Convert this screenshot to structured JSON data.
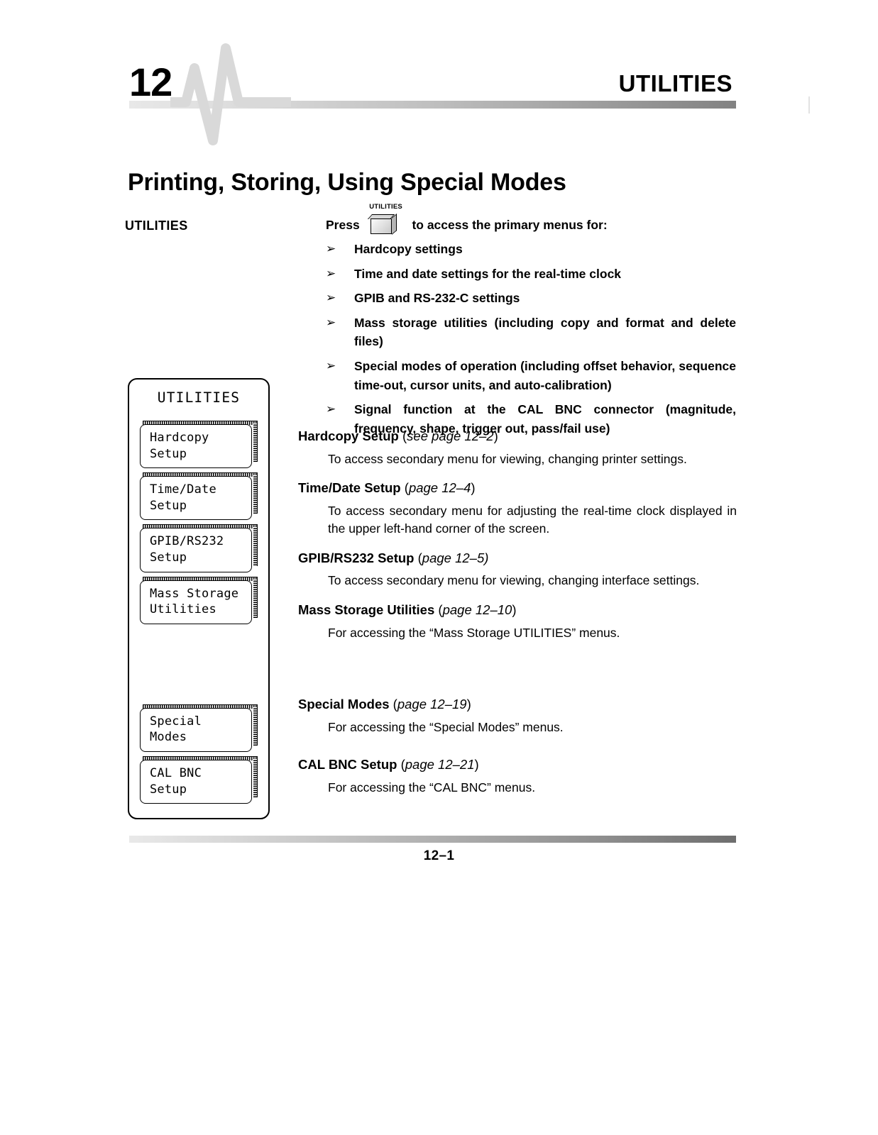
{
  "header": {
    "chapter_number": "12",
    "chapter_title": "UTILITIES",
    "wave_icon": "ecg-waveform-icon"
  },
  "page_title": "Printing, Storing, Using Special Modes",
  "margin_label": "UTILITIES",
  "intro": {
    "press_word": "Press",
    "key_label": "UTILITIES",
    "trailing": "to access the primary menus for:",
    "bullet_glyph": "➢"
  },
  "bullets": [
    "Hardcopy settings",
    "Time and date settings for the real-time clock",
    "GPIB and RS-232-C settings",
    "Mass storage utilities (including copy and format and delete files)",
    "Special modes of operation (including offset behavior, sequence time-out, cursor units, and auto-calibration)",
    "Signal function at the CAL BNC connector (magnitude, frequency, shape, trigger out, pass/fail use)"
  ],
  "menu_panel": {
    "title": "UTILITIES",
    "buttons": [
      {
        "line1": "Hardcopy",
        "line2": "Setup"
      },
      {
        "line1": "Time/Date",
        "line2": "Setup"
      },
      {
        "line1": "GPIB/RS232",
        "line2": "Setup"
      },
      {
        "line1": "Mass Storage",
        "line2": "Utilities"
      },
      {
        "line1": "Special",
        "line2": "Modes"
      },
      {
        "line1": "CAL BNC",
        "line2": "Setup"
      }
    ]
  },
  "entries": [
    {
      "name": "Hardcopy Setup",
      "reference": "(see page 12–2)",
      "ref_open": "(",
      "ref_italic": "see page 12–2",
      "ref_close": ")",
      "body": "To access secondary menu for viewing, changing printer settings."
    },
    {
      "name": "Time/Date Setup",
      "reference": "(page 12–4)",
      "ref_open": "(",
      "ref_italic": "page 12–4",
      "ref_close": ")",
      "body": "To access secondary menu for adjusting the real-time clock displayed in the upper left-hand corner of the screen."
    },
    {
      "name": "GPIB/RS232 Setup",
      "reference": "(page 12–5)",
      "ref_open": "(",
      "ref_italic": "page 12–5)",
      "ref_close": "",
      "body": "To access secondary menu for viewing, changing interface settings."
    },
    {
      "name": "Mass Storage Utilities",
      "reference": "(page 12–10)",
      "ref_open": "(",
      "ref_italic": "page 12–10",
      "ref_close": ")",
      "body": "For accessing the “Mass Storage UTILITIES” menus."
    }
  ],
  "entries_lower": [
    {
      "name": "Special Modes",
      "ref_open": "(",
      "ref_italic": "page 12–19",
      "ref_close": ")",
      "body": "For accessing the “Special Modes” menus."
    },
    {
      "name": "CAL BNC Setup",
      "ref_open": "(",
      "ref_italic": "page 12–21",
      "ref_close": ")",
      "body": "For accessing the “CAL BNC” menus."
    }
  ],
  "footer": {
    "page_number": "12–1"
  },
  "colors": {
    "text": "#000000",
    "background": "#ffffff",
    "rule_light": "#e9e9e9",
    "rule_dark": "#6e6e6e",
    "wave": "#d9d9d9"
  }
}
